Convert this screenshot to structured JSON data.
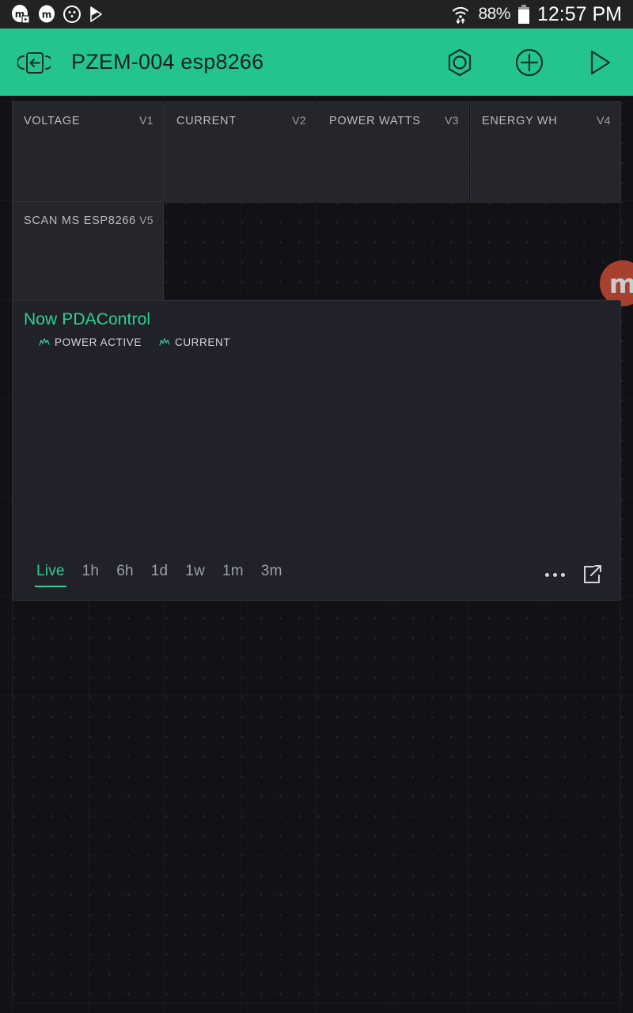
{
  "statusbar": {
    "icons": [
      "app-badge-icon",
      "app-badge-icon",
      "face-circle-icon",
      "play-store-icon"
    ],
    "wifi_icon": "wifi-data-icon",
    "battery_percent": "88%",
    "battery_icon": "battery-icon",
    "time": "12:57 PM"
  },
  "appbar": {
    "back_icon": "exit-app-icon",
    "title": "PZEM-004 esp8266",
    "actions": [
      {
        "name": "hexagon-nut-icon",
        "label": "hexagon-nut-icon"
      },
      {
        "name": "plus-circle-icon",
        "label": "plus-circle-icon"
      },
      {
        "name": "play-icon",
        "label": "play-icon"
      }
    ]
  },
  "tiles": [
    {
      "label": "VOLTAGE",
      "pin": "V1"
    },
    {
      "label": "CURRENT",
      "pin": "V2"
    },
    {
      "label": "POWER WATTS",
      "pin": "V3"
    },
    {
      "label": "ENERGY WH",
      "pin": "V4"
    },
    {
      "label": "SCAN MS ESP8266",
      "pin": "V5"
    }
  ],
  "chart": {
    "title": "Now PDAControl",
    "legend": [
      {
        "label": "POWER ACTIVE",
        "icon": "line-chart-icon",
        "color": "#2ecf96"
      },
      {
        "label": "CURRENT",
        "icon": "line-chart-icon",
        "color": "#2ecf96"
      }
    ],
    "ranges": [
      {
        "label": "Live",
        "active": true
      },
      {
        "label": "1h",
        "active": false
      },
      {
        "label": "6h",
        "active": false
      },
      {
        "label": "1d",
        "active": false
      },
      {
        "label": "1w",
        "active": false
      },
      {
        "label": "1m",
        "active": false
      },
      {
        "label": "3m",
        "active": false
      }
    ],
    "menu_icon": "more-options-icon",
    "expand_icon": "expand-chart-icon"
  },
  "watermark": {
    "letter": "m",
    "color": "#a8402f"
  },
  "colors": {
    "accent": "#23c48e",
    "chart_accent": "#2ecf96",
    "board_bg": "#121216",
    "tile_bg": "#25262b",
    "statusbar_bg": "#222225"
  }
}
